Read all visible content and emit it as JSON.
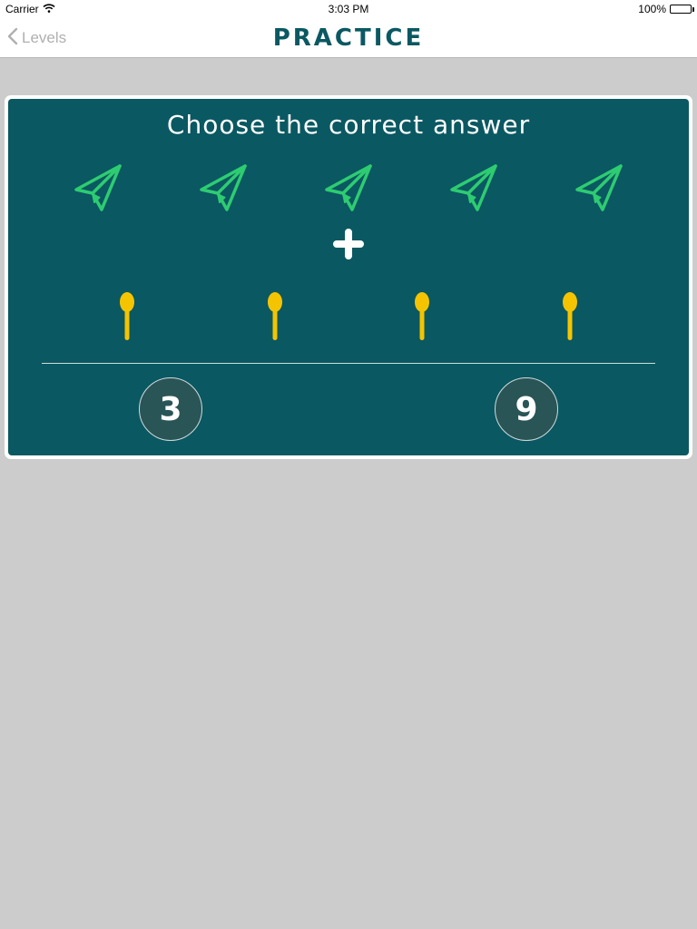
{
  "status_bar": {
    "carrier": "Carrier",
    "time": "3:03 PM",
    "battery_text": "100%",
    "battery_level": 1.0
  },
  "nav": {
    "back_label": "Levels",
    "title": "PRACTICE"
  },
  "quiz": {
    "question": "Choose the correct answer",
    "operator": "+",
    "group1": {
      "icon": "paper-plane-icon",
      "count": 5,
      "color": "#2ecc71"
    },
    "group2": {
      "icon": "spoon-icon",
      "count": 4,
      "color": "#f5c400"
    },
    "answers": [
      "3",
      "9"
    ]
  },
  "colors": {
    "board": "#0a5862",
    "background": "#cccccc",
    "title": "#0a5862",
    "answer_button": "#2a5557"
  }
}
